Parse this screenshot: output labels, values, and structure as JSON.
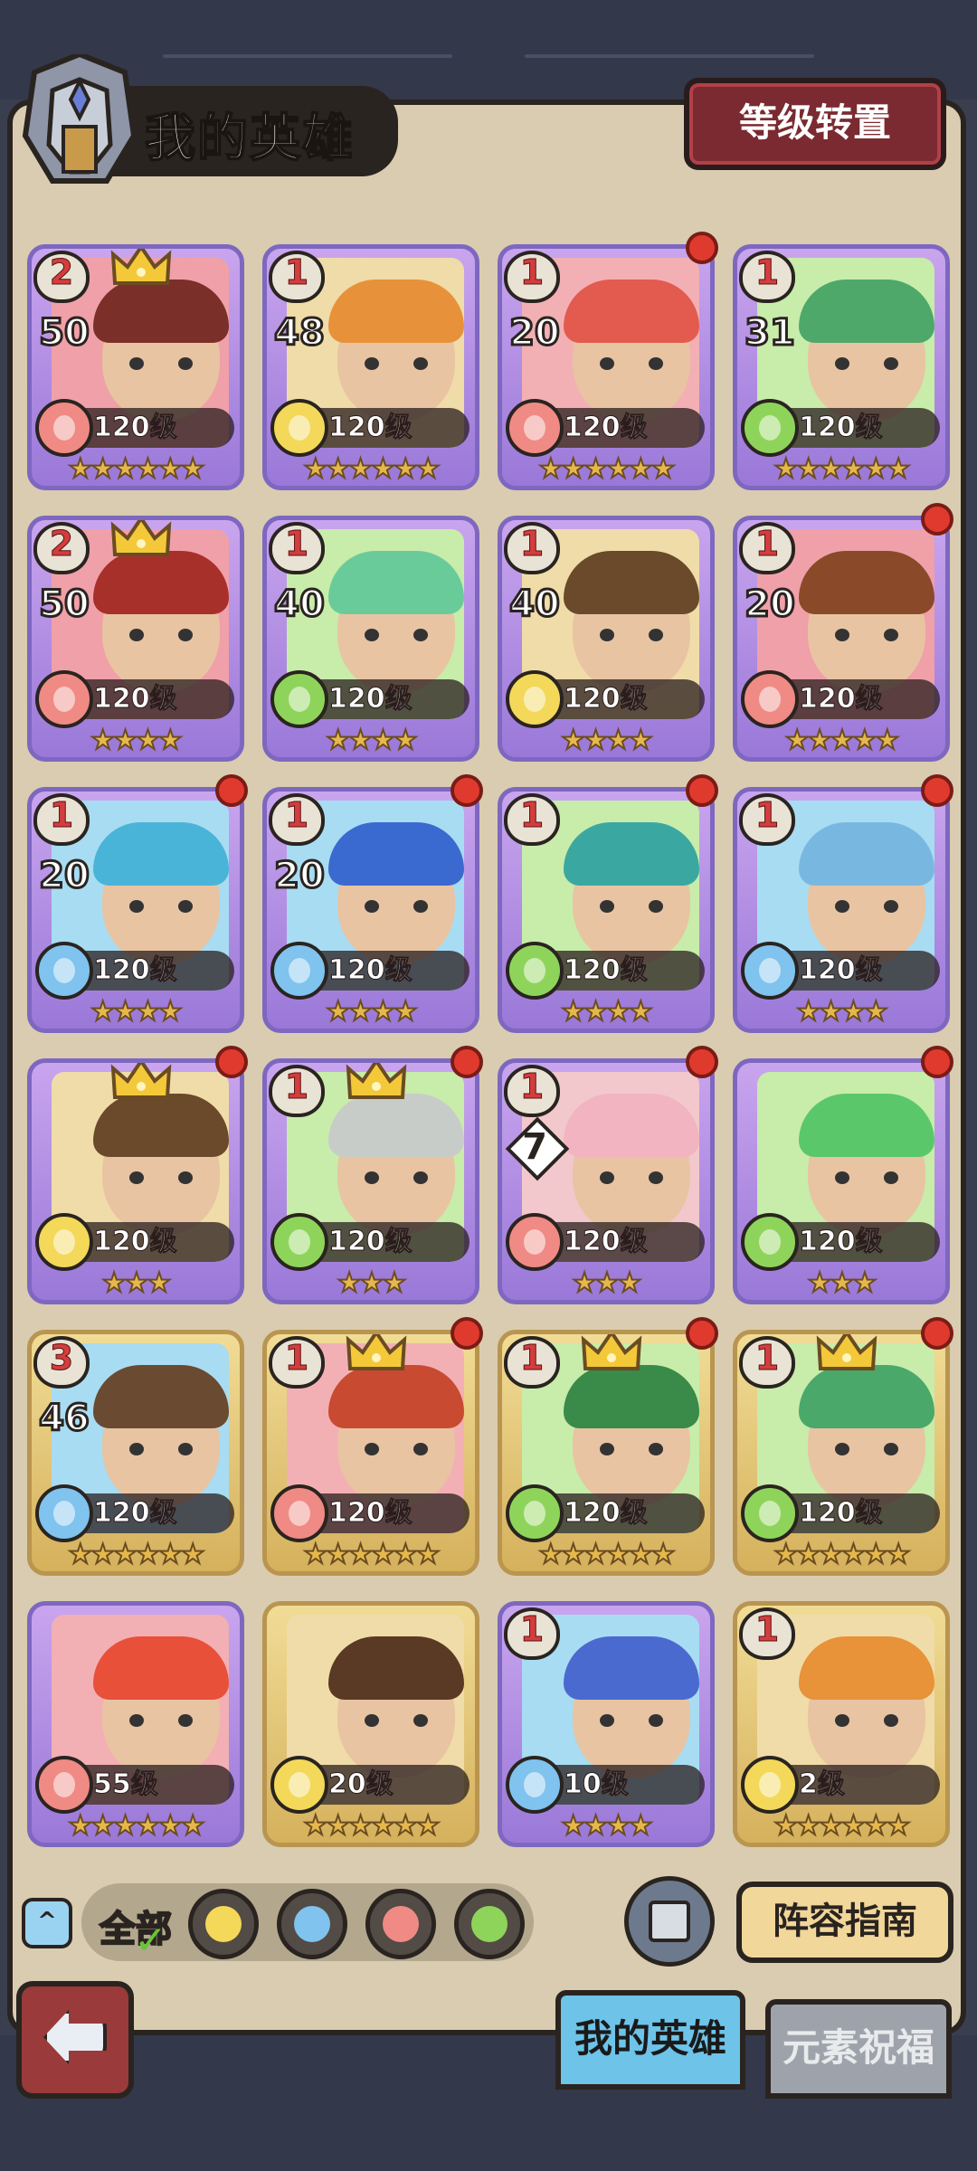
{
  "header": {
    "title": "我的英雄",
    "transfer_button": "等级转置"
  },
  "heroes": [
    {
      "rank": "2",
      "badge": "50",
      "level": "120级",
      "stars": "★★★★★★",
      "element": "fire",
      "crown": true,
      "dot": false,
      "frame": "purple",
      "hair": "#7a2f28",
      "bg": "#f0a0a8"
    },
    {
      "rank": "1",
      "badge": "48",
      "level": "120级",
      "stars": "★★★★★★",
      "element": "earth",
      "crown": false,
      "dot": false,
      "frame": "purple",
      "hair": "#e7923a",
      "bg": "#f0dca8"
    },
    {
      "rank": "1",
      "badge": "20",
      "level": "120级",
      "stars": "★★★★★★",
      "element": "fire",
      "crown": false,
      "dot": true,
      "frame": "purple",
      "hair": "#e25b4e",
      "bg": "#f2b0b4"
    },
    {
      "rank": "1",
      "badge": "31",
      "level": "120级",
      "stars": "★★★★★★",
      "element": "wind",
      "crown": false,
      "dot": false,
      "frame": "purple",
      "hair": "#4da86a",
      "bg": "#c8ecaa"
    },
    {
      "rank": "2",
      "badge": "50",
      "level": "120级",
      "stars": "★★★★",
      "element": "fire",
      "crown": true,
      "dot": false,
      "frame": "purple",
      "hair": "#a8302a",
      "bg": "#f0a0a8"
    },
    {
      "rank": "1",
      "badge": "40",
      "level": "120级",
      "stars": "★★★★",
      "element": "wind",
      "crown": false,
      "dot": false,
      "frame": "purple",
      "hair": "#6acb9a",
      "bg": "#c8ecaa"
    },
    {
      "rank": "1",
      "badge": "40",
      "level": "120级",
      "stars": "★★★★",
      "element": "earth",
      "crown": false,
      "dot": false,
      "frame": "purple",
      "hair": "#6a4a2a",
      "bg": "#f0dca8"
    },
    {
      "rank": "1",
      "badge": "20",
      "level": "120级",
      "stars": "★★★★★",
      "element": "fire",
      "crown": false,
      "dot": true,
      "frame": "purple",
      "hair": "#8a4a2a",
      "bg": "#f0a0a8"
    },
    {
      "rank": "1",
      "badge": "20",
      "level": "120级",
      "stars": "★★★★",
      "element": "water",
      "crown": false,
      "dot": true,
      "frame": "purple",
      "hair": "#4ab4d8",
      "bg": "#a8dcf2"
    },
    {
      "rank": "1",
      "badge": "20",
      "level": "120级",
      "stars": "★★★★",
      "element": "water",
      "crown": false,
      "dot": true,
      "frame": "purple",
      "hair": "#3a6ad0",
      "bg": "#a8dcf2"
    },
    {
      "rank": "1",
      "badge": "",
      "level": "120级",
      "stars": "★★★★",
      "element": "wind",
      "crown": false,
      "dot": true,
      "frame": "purple",
      "hair": "#3aa8a0",
      "bg": "#c8ecaa"
    },
    {
      "rank": "1",
      "badge": "",
      "level": "120级",
      "stars": "★★★★",
      "element": "water",
      "crown": false,
      "dot": true,
      "frame": "purple",
      "hair": "#78b8e0",
      "bg": "#a8dcf2"
    },
    {
      "rank": "",
      "badge": "",
      "level": "120级",
      "stars": "★★★",
      "element": "earth",
      "crown": true,
      "dot": true,
      "frame": "purple",
      "hair": "#6a4a2a",
      "bg": "#f0dca8"
    },
    {
      "rank": "1",
      "badge": "",
      "level": "120级",
      "stars": "★★★",
      "element": "wind",
      "crown": true,
      "dot": true,
      "frame": "purple",
      "hair": "#c8ccc8",
      "bg": "#c8ecaa"
    },
    {
      "rank": "1",
      "badge": "7",
      "level": "120级",
      "stars": "★★★",
      "element": "fire",
      "crown": false,
      "dot": true,
      "frame": "purple",
      "hair": "#f2b4c0",
      "bg": "#f2c8cc"
    },
    {
      "rank": "",
      "badge": "",
      "level": "120级",
      "stars": "★★★",
      "element": "wind",
      "crown": false,
      "dot": true,
      "frame": "purple",
      "hair": "#5ac86a",
      "bg": "#c8ecaa"
    },
    {
      "rank": "3",
      "badge": "46",
      "level": "120级",
      "stars": "★★★★★★",
      "element": "water",
      "crown": false,
      "dot": false,
      "frame": "gold",
      "hair": "#6a4a30",
      "bg": "#a8dcf2"
    },
    {
      "rank": "1",
      "badge": "",
      "level": "120级",
      "stars": "★★★★★★",
      "element": "fire",
      "crown": true,
      "dot": true,
      "frame": "gold",
      "hair": "#c84a30",
      "bg": "#f2b0b4"
    },
    {
      "rank": "1",
      "badge": "",
      "level": "120级",
      "stars": "★★★★★★",
      "element": "wind",
      "crown": true,
      "dot": true,
      "frame": "gold",
      "hair": "#3a8a4a",
      "bg": "#c8ecaa"
    },
    {
      "rank": "1",
      "badge": "",
      "level": "120级",
      "stars": "★★★★★★",
      "element": "wind",
      "crown": true,
      "dot": true,
      "frame": "gold",
      "hair": "#4aa86a",
      "bg": "#c8ecaa"
    },
    {
      "rank": "",
      "badge": "",
      "level": "55级",
      "stars": "★★★★★★",
      "element": "fire",
      "crown": false,
      "dot": false,
      "frame": "purple",
      "hair": "#e8503a",
      "bg": "#f2b0b4"
    },
    {
      "rank": "",
      "badge": "",
      "level": "20级",
      "stars": "★★★★★★",
      "element": "earth",
      "crown": false,
      "dot": false,
      "frame": "gold",
      "hair": "#5a3a24",
      "bg": "#f0dca8"
    },
    {
      "rank": "1",
      "badge": "",
      "level": "10级",
      "stars": "★★★★",
      "element": "water",
      "crown": false,
      "dot": false,
      "frame": "purple",
      "hair": "#4a6ad0",
      "bg": "#a8dcf2"
    },
    {
      "rank": "1",
      "badge": "",
      "level": "2级",
      "stars": "★★★★★★",
      "element": "earth",
      "crown": false,
      "dot": false,
      "frame": "gold",
      "hair": "#e8923a",
      "bg": "#f0dca8"
    }
  ],
  "filters": {
    "all_label": "全部",
    "elements": [
      "earth",
      "water",
      "fire",
      "wind"
    ]
  },
  "actions": {
    "lineup_guide": "阵容指南"
  },
  "tabs": {
    "my_heroes": "我的英雄",
    "blessing": "元素祝福"
  },
  "colors": {
    "fire": "#f08a84",
    "earth": "#f3d85a",
    "water": "#7fc3ee",
    "wind": "#8fd45a"
  }
}
